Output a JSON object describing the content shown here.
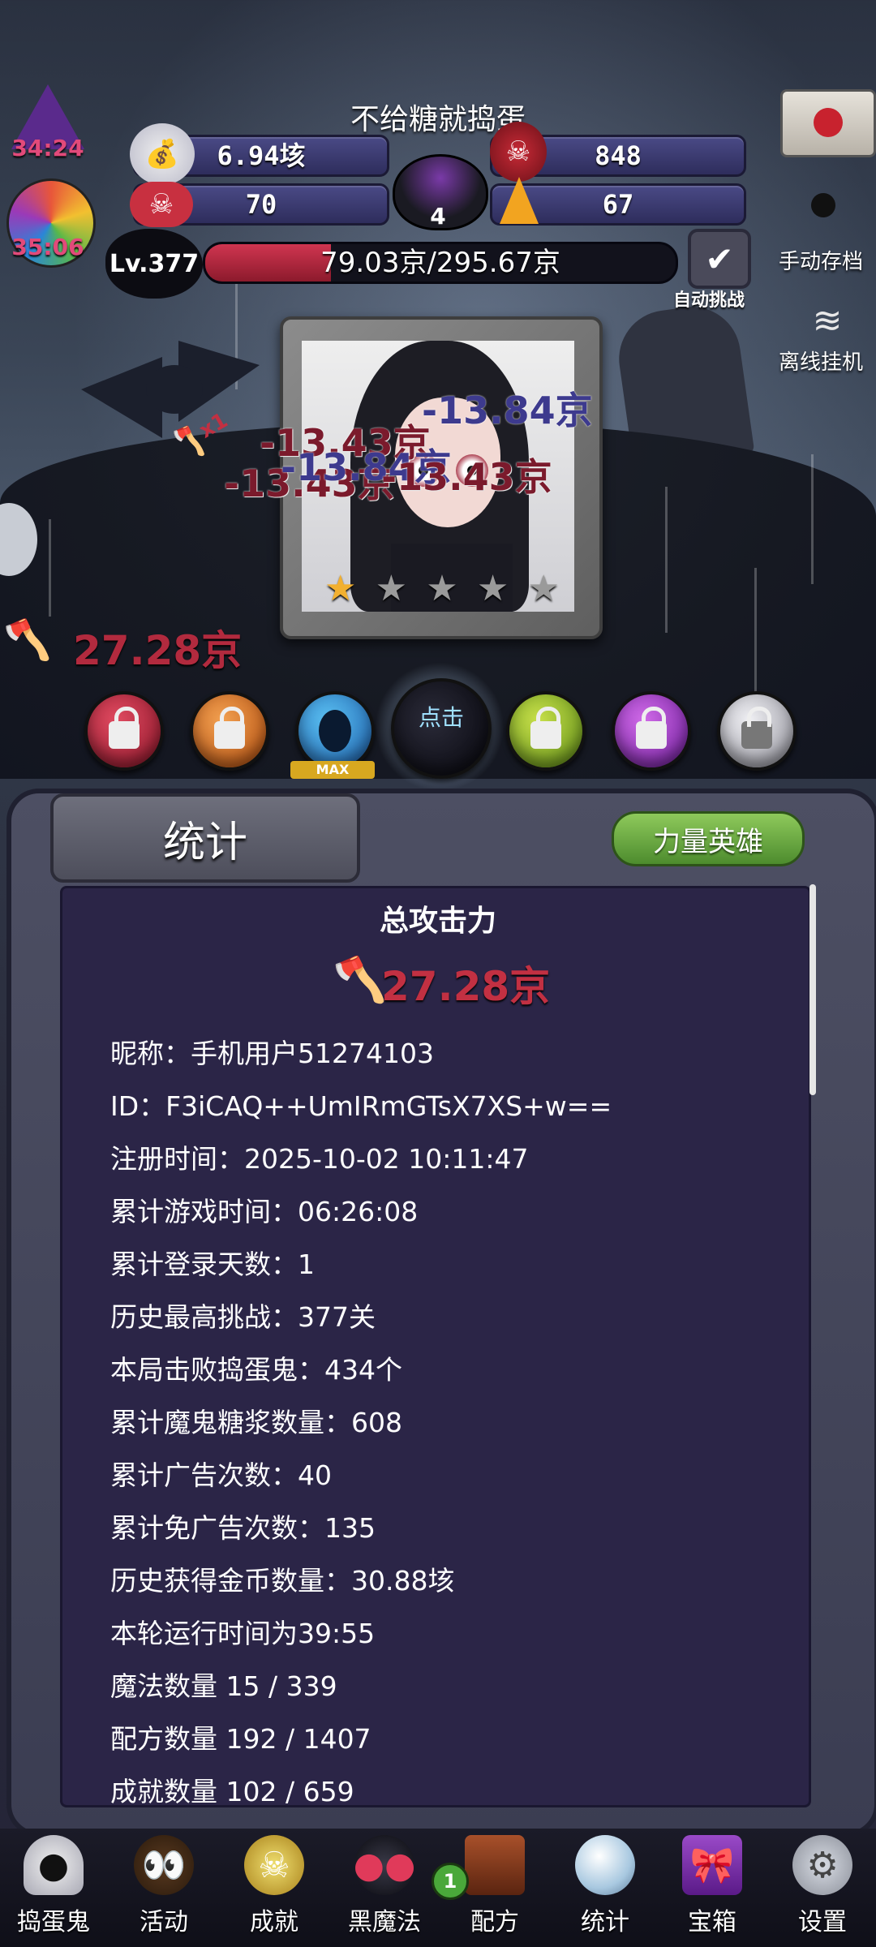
{
  "header": {
    "title": "不给糖就捣蛋",
    "left_badges": {
      "hat_timer": "34:24",
      "candy_timer": "35:06"
    },
    "stats": {
      "gold": "6.94垓",
      "skull_count": "848",
      "bone_candy": "70",
      "corn_candy": "67",
      "cauldron_count": "4"
    },
    "level": "Lv.377",
    "hp_text": "79.03京/295.67京",
    "hp_fraction": 0.267,
    "auto_challenge_label": "自动挑战",
    "manual_save_label": "手动存档",
    "offline_label": "离线挂机"
  },
  "battle": {
    "damage_texts": [
      "-13.43京",
      "-13.84京",
      "-13.43京",
      "-13.84京",
      "-13.43京"
    ],
    "bat_multiplier": "x1",
    "attack_power": "27.28京",
    "stars_lit": 1,
    "stars_total": 5
  },
  "skills": {
    "active_label": "点击",
    "max_label": "MAX",
    "colors": [
      "#b01a34",
      "#e0741c",
      "#2a8ed8",
      "#1a1a22",
      "#8ab828",
      "#8a2ab8",
      "#b8b8c0"
    ]
  },
  "panel": {
    "tab_label": "统计",
    "hero_button_label": "力量英雄",
    "section_title": "总攻击力",
    "total_attack": "27.28京",
    "rows": [
      "昵称：手机用户51274103",
      "ID：F3iCAQ++UmIRmGTsX7XS+w==",
      "注册时间：2025-10-02 10:11:47",
      "累计游戏时间：06:26:08",
      "累计登录天数：1",
      "历史最高挑战：377关",
      "本局击败捣蛋鬼：434个",
      "累计魔鬼糖浆数量：608",
      "累计广告次数：40",
      "累计免广告次数：135",
      "历史获得金币数量：30.88垓",
      "本轮运行时间为39:55",
      "魔法数量 15 / 339",
      "配方数量 192 / 1407",
      "成就数量 102 / 659"
    ]
  },
  "nav": {
    "items": [
      {
        "label": "捣蛋鬼",
        "icon": "ghost-icon"
      },
      {
        "label": "活动",
        "icon": "basket-icon"
      },
      {
        "label": "成就",
        "icon": "trophy-icon"
      },
      {
        "label": "黑魔法",
        "icon": "devil-icon"
      },
      {
        "label": "配方",
        "icon": "book-icon"
      },
      {
        "label": "统计",
        "icon": "crystal-ball-icon"
      },
      {
        "label": "宝箱",
        "icon": "gift-icon"
      },
      {
        "label": "设置",
        "icon": "gear-icon"
      }
    ],
    "recipe_badge": "1"
  }
}
